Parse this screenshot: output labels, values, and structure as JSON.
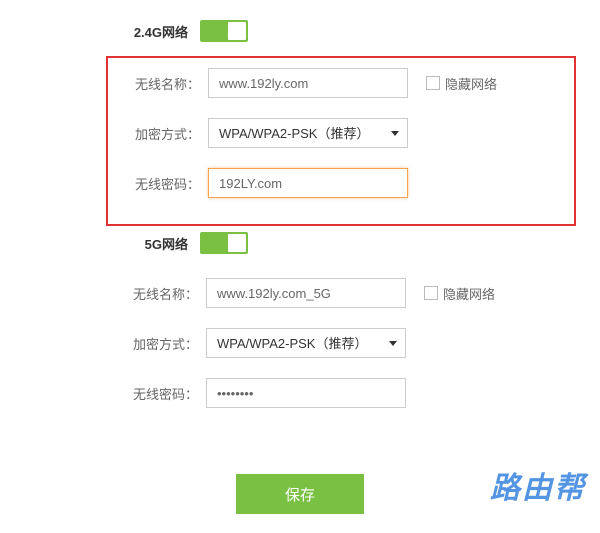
{
  "band24": {
    "title": "2.4G网络",
    "toggle_on": true,
    "fields": {
      "ssid_label": "无线名称：",
      "ssid_value": "www.192ly.com",
      "hide_label": "隐藏网络",
      "hide_checked": false,
      "encryption_label": "加密方式：",
      "encryption_value": "WPA/WPA2-PSK（推荐）",
      "password_label": "无线密码：",
      "password_value": "192LY.com"
    }
  },
  "band5": {
    "title": "5G网络",
    "toggle_on": true,
    "fields": {
      "ssid_label": "无线名称：",
      "ssid_value": "www.192ly.com_5G",
      "hide_label": "隐藏网络",
      "hide_checked": false,
      "encryption_label": "加密方式：",
      "encryption_value": "WPA/WPA2-PSK（推荐）",
      "password_label": "无线密码：",
      "password_value": "••••••••"
    }
  },
  "actions": {
    "save_label": "保存"
  },
  "watermark": "路由帮"
}
